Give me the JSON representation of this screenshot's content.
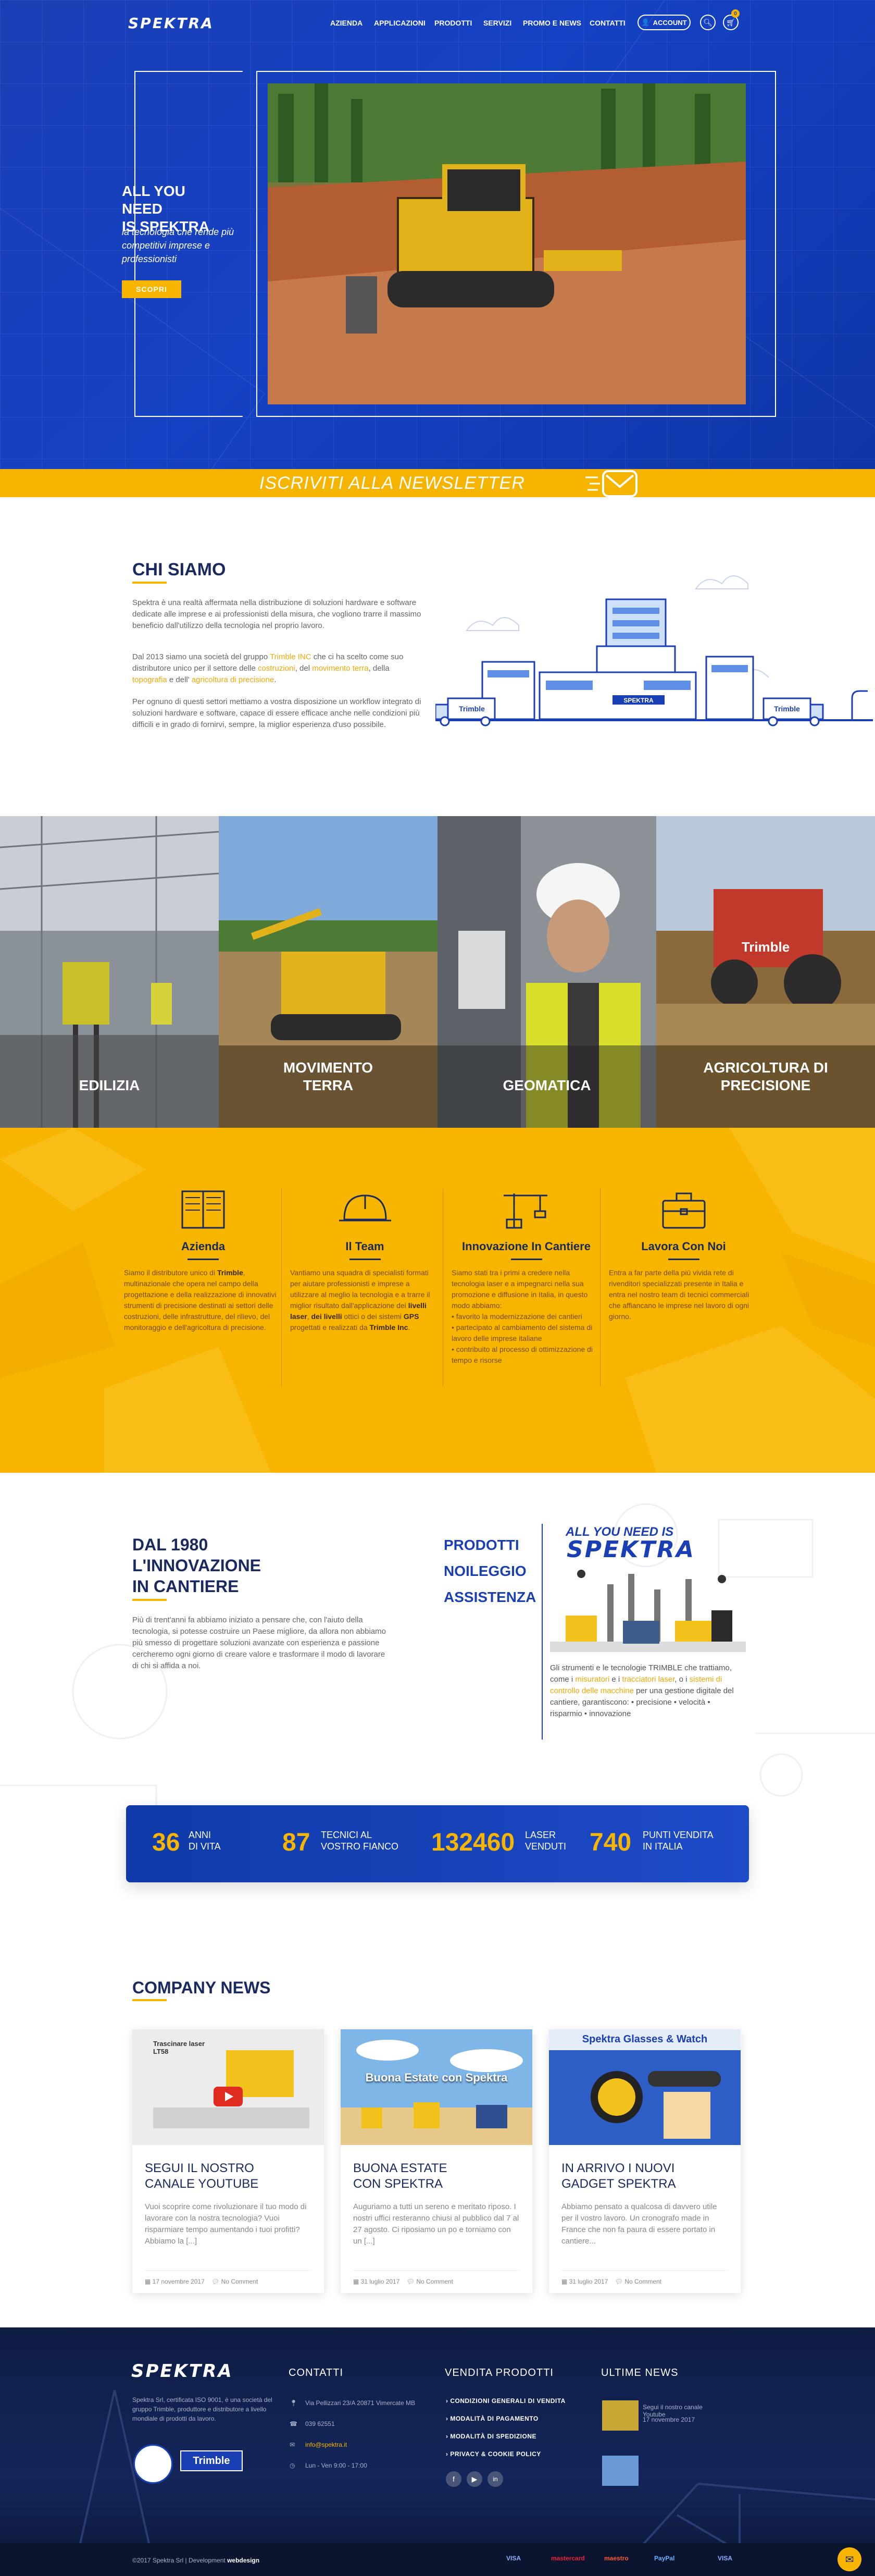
{
  "header": {
    "logo": "SPEKTRA",
    "nav": [
      "AZIENDA",
      "APPLICAZIONI",
      "PRODOTTI",
      "SERVIZI",
      "PROMO E NEWS",
      "CONTATTI"
    ],
    "account_label": "ACCOUNT",
    "cart_count": "0"
  },
  "hero": {
    "title_line1": "ALL YOU NEED",
    "title_line2": "IS SPEKTRA",
    "subtitle": "la tecnologia che rende più competitivi imprese e professionisti",
    "button": "SCOPRI"
  },
  "newsletter": {
    "label": "ISCRIVITI ALLA NEWSLETTER"
  },
  "chi_siamo": {
    "title": "CHI SIAMO",
    "p1": "Spektra è una realtà affermata nella distribuzione di soluzioni hardware e software dedicate alle imprese e ai professionisti della misura, che vogliono trarre il massimo beneficio dall'utilizzo della tecnologia nel proprio lavoro.",
    "p2_a": "Dal 2013 siamo una società del gruppo ",
    "p2_link1": "Trimble INC",
    "p2_b": " che ci ha scelto come suo distributore unico per il settore delle ",
    "p2_link2": "costruzioni",
    "p2_c": ", del ",
    "p2_link3": "movimento terra",
    "p2_d": ", della ",
    "p2_link4": "topografia",
    "p2_e": " e dell' ",
    "p2_link5": "agricoltura di precisione",
    "p2_f": ".",
    "p3": "Per ognuno di questi settori mettiamo a vostra disposizione un workflow integrato di soluzioni hardware e software, capace di essere efficace anche nelle condizioni più difficili e in grado di fornirvi, sempre, la miglior esperienza d'uso possibile.",
    "illustration_sign": "SPEKTRA",
    "truck_label": "Trimble"
  },
  "categories": [
    {
      "label_line1": "EDILIZIA",
      "label_line2": ""
    },
    {
      "label_line1": "MOVIMENTO",
      "label_line2": "TERRA"
    },
    {
      "label_line1": "GEOMATICA",
      "label_line2": ""
    },
    {
      "label_line1": "AGRICOLTURA DI",
      "label_line2": "PRECISIONE"
    }
  ],
  "features": [
    {
      "title": "Azienda",
      "icon": "building-icon",
      "text_html": "Siamo il distributore unico di <b>Trimble</b>, multinazionale che opera nel campo della progettazione e della realizzazione di innovativi strumenti di precisione destinati ai settori delle costruzioni, delle infrastrutture, del rilievo, del monitoraggio e dell'agricoltura di precisione."
    },
    {
      "title": "Il Team",
      "icon": "hardhat-icon",
      "text_html": "Vantiamo una squadra di specialisti formati per aiutare professionisti e imprese a utilizzare al meglio la tecnologia e a trarre il miglior risultato dall'applicazione dei <b>livelli laser</b>, <b>dei livelli</b> ottici o dei sistemi <b>GPS</b> progettati e realizzati da <b>Trimble Inc</b>."
    },
    {
      "title": "Innovazione In Cantiere",
      "icon": "crane-icon",
      "text_html": "Siamo stati tra i primi a credere nella tecnologia laser e a impegnarci nella sua promozione e diffusione in Italia, in questo modo abbiamo:<br>• favorito la modernizzazione dei cantieri<br>• partecipato al cambiamento del sistema di lavoro delle imprese italiane<br>• contribuito al processo di ottimizzazione di tempo e risorse"
    },
    {
      "title": "Lavora Con Noi",
      "icon": "briefcase-icon",
      "text_html": "Entra a far parte della più vivida rete di rivenditori specializzati presente in Italia e entra nel nostro team di tecnici commerciali che affiancano le imprese nel lavoro di ogni giorno."
    }
  ],
  "innovazione": {
    "title_line1": "DAL 1980",
    "title_line2": "L'INNOVAZIONE",
    "title_line3": "IN CANTIERE",
    "text": "Più di trent'anni fa abbiamo iniziato a pensare che, con l'aiuto della tecnologia, si potesse costruire un Paese migliore, da allora non abbiamo più smesso di progettare soluzioni avanzate con esperienza e passione cercheremo ogni giorno di creare valore e trasformare il modo di lavorare di chi si affida a noi.",
    "links": [
      "PRODOTTI",
      "NOILEGGIO",
      "ASSISTENZA"
    ],
    "brand_top": "ALL YOU NEED IS",
    "brand_logo": "SPEKTRA",
    "side_a": "Gli strumenti e le tecnologie TRIMBLE che trattiamo, come i ",
    "side_link1": "misuratori",
    "side_b": " e i ",
    "side_link2": "tracciatori laser",
    "side_c": ", o i ",
    "side_link3": "sistemi di controllo delle macchine",
    "side_d": " per una gestione digitale del cantiere, garantiscono: • precisione • velocità • risparmio • innovazione"
  },
  "stats": [
    {
      "value": "36",
      "label_line1": "ANNI",
      "label_line2": "DI VITA"
    },
    {
      "value": "87",
      "label_line1": "TECNICI AL",
      "label_line2": "VOSTRO FIANCO"
    },
    {
      "value": "132460",
      "label_line1": "LASER",
      "label_line2": "VENDUTI"
    },
    {
      "value": "740",
      "label_line1": "PUNTI VENDITA",
      "label_line2": "IN ITALIA"
    }
  ],
  "news": {
    "title": "COMPANY NEWS",
    "items": [
      {
        "title_line1": "SEGUI IL NOSTRO",
        "title_line2": "CANALE YOUTUBE",
        "text": "Vuoi scoprire come rivoluzionare il tuo modo di lavorare con la nostra tecnologia? Vuoi risparmiare tempo aumentando i tuoi profitti? Abbiamo la [...]",
        "date": "17 novembre 2017",
        "comments": "No Comment",
        "img_caption": "Trascinare laser LT58"
      },
      {
        "title_line1": "BUONA ESTATE",
        "title_line2": "CON SPEKTRA",
        "text": "Auguriamo a tutti un sereno e meritato riposo. I nostri uffici resteranno chiusi al pubblico dal 7 al 27 agosto. Ci riposiamo un po e torniamo con un [...]",
        "date": "31 luglio 2017",
        "comments": "No Comment",
        "img_caption": "Buona Estate con Spektra"
      },
      {
        "title_line1": "IN ARRIVO I NUOVI",
        "title_line2": "GADGET SPEKTRA",
        "text": "Abbiamo pensato a qualcosa di davvero utile per il vostro lavoro. Un cronografo made in France che non fa paura di essere portato in cantiere...",
        "date": "31 luglio 2017",
        "comments": "No Comment",
        "img_caption": "Spektra Glasses & Watch"
      }
    ]
  },
  "footer": {
    "logo": "SPEKTRA",
    "about": "Spektra Srl, certificata ISO 9001, è una società del gruppo Trimble, produttore e distributore a livello mondiale di prodotti da lavoro.",
    "contatti_title": "CONTATTI",
    "address": "Via Pellizzari 23/A 20871 Vimercate MB",
    "phone": "039 62551",
    "email": "info@spektra.it",
    "hours": "Lun - Ven 9:00 - 17:00",
    "vendita_title": "VENDITA PRODOTTI",
    "vendita_links": [
      "CONDIZIONI GENERALI DI VENDITA",
      "MODALITÀ DI PAGAMENTO",
      "MODALITÀ DI SPEDIZIONE",
      "PRIVACY & COOKIE POLICY"
    ],
    "news_title": "ULTIME NEWS",
    "news_items": [
      "Segui il nostro canale Youtube",
      "17 novembre 2017"
    ],
    "copyright": "©2017 Spektra Srl | Development ",
    "developer": "webdesign",
    "payments": [
      "VISA",
      "mastercard",
      "maestro",
      "PayPal",
      "VISA"
    ],
    "trimble_badge": "Trimble"
  }
}
